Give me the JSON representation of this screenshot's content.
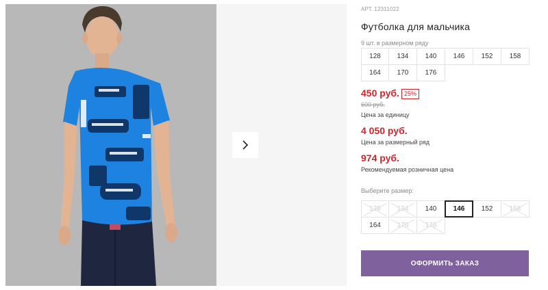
{
  "product": {
    "article_prefix": "АРТ.",
    "article": "12311022",
    "title": "Футболка для мальчика",
    "row_note": "9 шт. в размерном ряду",
    "image_alt": "Фото товара: мальчик в синей футболке с принтом"
  },
  "reference_sizes": [
    "128",
    "134",
    "140",
    "146",
    "152",
    "158",
    "164",
    "170",
    "176"
  ],
  "prices": {
    "unit": "450 руб.",
    "discount": "25%",
    "old": "600 руб.",
    "unit_label": "Цена за единицу",
    "row": "4 050 руб.",
    "row_label": "Цена за размерный ряд",
    "retail": "974 руб.",
    "retail_label": "Рекомендуемая розничная цена"
  },
  "size_picker": {
    "label": "Выберите размер:",
    "sizes": [
      {
        "label": "128",
        "available": false
      },
      {
        "label": "134",
        "available": false
      },
      {
        "label": "140",
        "available": true
      },
      {
        "label": "146",
        "available": true,
        "selected": true
      },
      {
        "label": "152",
        "available": true
      },
      {
        "label": "158",
        "available": false
      },
      {
        "label": "164",
        "available": true
      },
      {
        "label": "170",
        "available": false
      },
      {
        "label": "176",
        "available": false
      }
    ]
  },
  "actions": {
    "order": "ОФОРМИТЬ ЗАКАЗ"
  },
  "icons": {
    "next": "chevron-right-icon"
  },
  "colors": {
    "accent": "#7e619d",
    "price": "#d2232a",
    "shirt": "#1e82e0"
  }
}
